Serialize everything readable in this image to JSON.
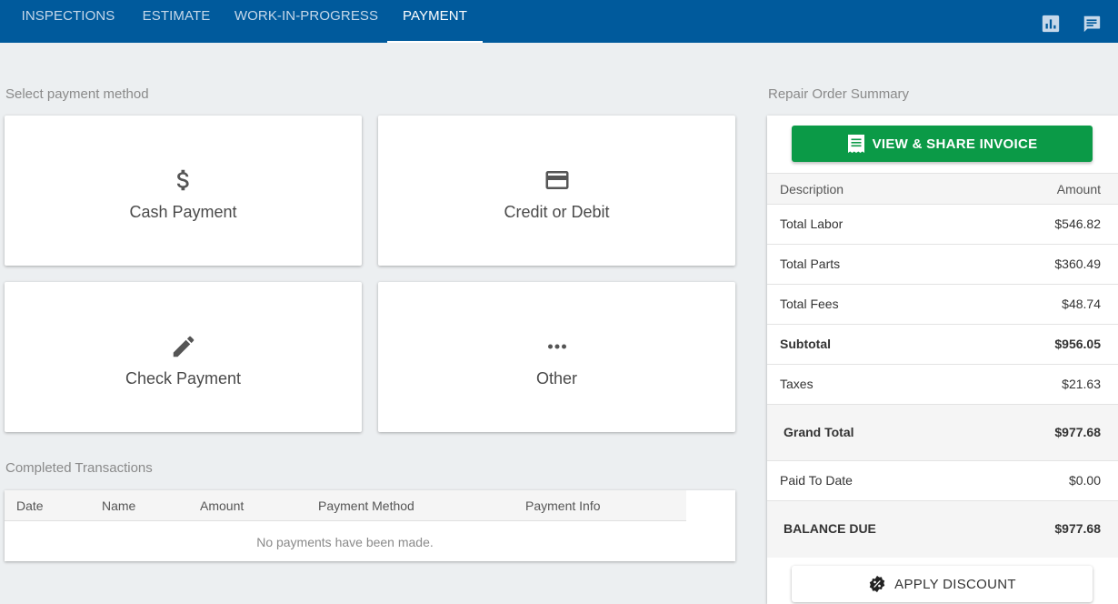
{
  "nav": {
    "tabs": [
      {
        "label": "INSPECTIONS"
      },
      {
        "label": "ESTIMATE"
      },
      {
        "label": "WORK-IN-PROGRESS"
      },
      {
        "label": "PAYMENT"
      }
    ],
    "active_tab": "PAYMENT",
    "icons": [
      "bar-chart-icon",
      "chat-icon"
    ]
  },
  "payment": {
    "section_label": "Select payment method",
    "methods": [
      {
        "label": "Cash Payment",
        "icon": "dollar-icon"
      },
      {
        "label": "Credit or Debit",
        "icon": "credit-card-icon"
      },
      {
        "label": "Check Payment",
        "icon": "pencil-icon"
      },
      {
        "label": "Other",
        "icon": "more-horizontal-icon"
      }
    ]
  },
  "transactions": {
    "section_label": "Completed Transactions",
    "columns": [
      "Date",
      "Name",
      "Amount",
      "Payment Method",
      "Payment Info"
    ],
    "empty_message": "No payments have been made."
  },
  "summary": {
    "section_label": "Repair Order Summary",
    "invoice_button": "VIEW & SHARE INVOICE",
    "header": {
      "description": "Description",
      "amount": "Amount"
    },
    "rows": [
      {
        "description": "Total Labor",
        "amount": "$546.82"
      },
      {
        "description": "Total Parts",
        "amount": "$360.49"
      },
      {
        "description": "Total Fees",
        "amount": "$48.74"
      },
      {
        "description": "Subtotal",
        "amount": "$956.05"
      },
      {
        "description": "Taxes",
        "amount": "$21.63"
      },
      {
        "description": "Grand Total",
        "amount": "$977.68"
      },
      {
        "description": "Paid To Date",
        "amount": "$0.00"
      },
      {
        "description": "BALANCE DUE",
        "amount": "$977.68"
      }
    ],
    "discount_button": "APPLY DISCOUNT"
  },
  "colors": {
    "nav_bg": "#005a9c",
    "invoice_button": "#0b9a47",
    "page_bg": "#eceff1"
  }
}
